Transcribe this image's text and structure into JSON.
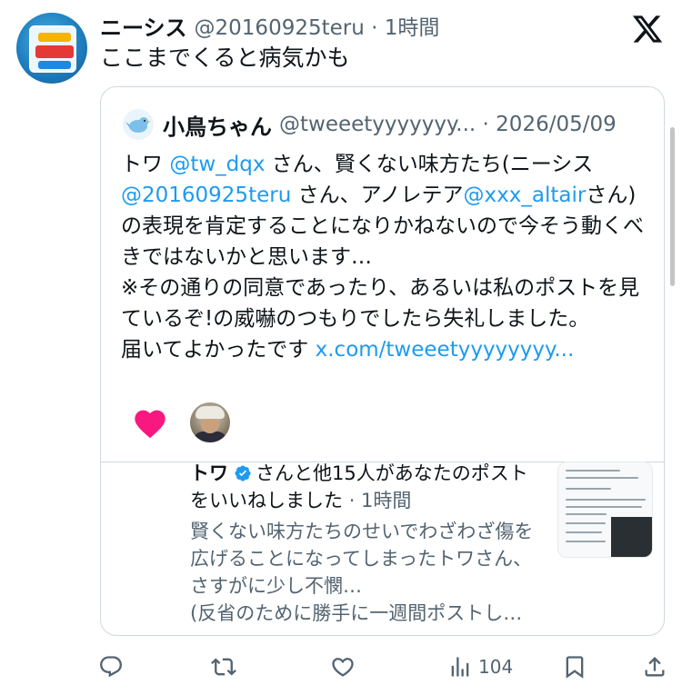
{
  "tweet": {
    "author_name": "ニーシス",
    "author_handle": "@20160925teru",
    "time": "1時間",
    "text": "ここまでくると病気かも"
  },
  "quote": {
    "author_name": "小鳥ちゃん",
    "author_handle": "@tweeetyyyyyyy...",
    "date": "2026/05/09",
    "text_parts": [
      "トワ ",
      "@tw_dqx",
      " さん、賢くない味方たち(ニーシス ",
      "@20160925teru",
      " さん、アノレテア",
      "@xxx_altair",
      "さん) の表現を肯定することになりかねないので今そう動くべきではないかと思います…",
      "※その通りの同意であったり、あるいは私のポストを見ているぞ!の威嚇のつもりでしたら失礼しました。",
      "届いてよかったです ",
      "x.com/tweeetyyyyyyyy..."
    ],
    "notification": {
      "name": "トワ",
      "text": "さんと他15人があなたのポストをいいねしました",
      "time": "· 1時間",
      "preview_line1": "賢くない味方たちのせいでわざわざ傷を広げることになってしまったトワさん、さすがに少し不憫…",
      "preview_line2": "(反省のために勝手に一週間ポストし…"
    }
  },
  "actions": {
    "reply_icon": "reply-icon",
    "repost_icon": "repost-icon",
    "like_icon": "like-icon",
    "views_icon": "views-icon",
    "views_count": "104",
    "bookmark_icon": "bookmark-icon",
    "share_icon": "share-icon"
  },
  "colors": {
    "link": "#1d9bf0",
    "heart": "#f91880",
    "verified": "#1d9bf0",
    "secondary_text": "#536471"
  }
}
